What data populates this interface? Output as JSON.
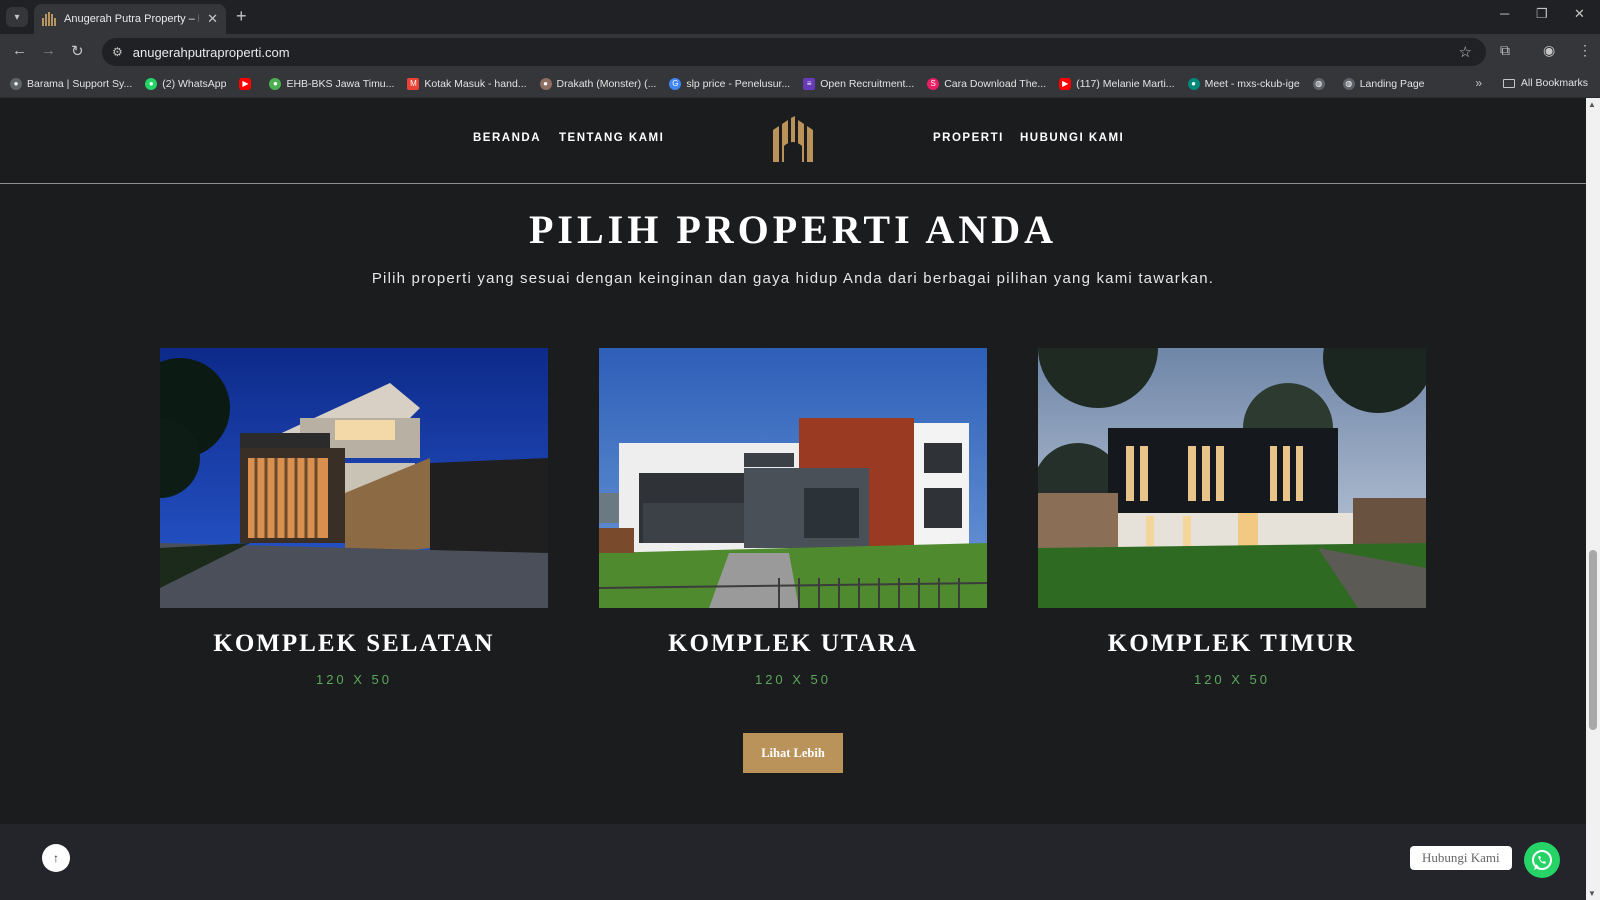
{
  "browser": {
    "tab_title": "Anugerah Putra Property – Kes",
    "url": "anugerahputraproperti.com",
    "bookmarks": [
      {
        "label": "Barama | Support Sy...",
        "color": "#5f6368"
      },
      {
        "label": "(2) WhatsApp",
        "color": "#25d366"
      },
      {
        "label": "",
        "color": "#ff0000"
      },
      {
        "label": "EHB-BKS Jawa Timu...",
        "color": "#4caf50"
      },
      {
        "label": "Kotak Masuk - hand...",
        "color": "#ea4335"
      },
      {
        "label": "Drakath (Monster) (...",
        "color": "#8d6e63"
      },
      {
        "label": "slp price - Penelusur...",
        "color": "#4285f4"
      },
      {
        "label": "Open Recruitment...",
        "color": "#673ab7"
      },
      {
        "label": "Cara Download The...",
        "color": "#e91e63"
      },
      {
        "label": "(117) Melanie Marti...",
        "color": "#ff0000"
      },
      {
        "label": "Meet - mxs-ckub-ige",
        "color": "#00897b"
      },
      {
        "label": "",
        "color": "#5f6368"
      },
      {
        "label": "Landing Page",
        "color": "#5f6368"
      }
    ],
    "all_bookmarks": "All Bookmarks"
  },
  "nav": {
    "home": "BERANDA",
    "about": "TENTANG KAMI",
    "property": "PROPERTI",
    "contact": "HUBUNGI KAMI"
  },
  "section": {
    "title": "PILIH PROPERTI ANDA",
    "subtitle": "Pilih properti yang sesuai dengan keinginan dan gaya hidup Anda dari berbagai pilihan yang kami tawarkan."
  },
  "properties": [
    {
      "name": "KOMPLEK SELATAN",
      "size": "120 X 50"
    },
    {
      "name": "KOMPLEK UTARA",
      "size": "120 X 50"
    },
    {
      "name": "KOMPLEK TIMUR",
      "size": "120 X 50"
    }
  ],
  "cta": {
    "label": "Lihat Lebih"
  },
  "floating": {
    "whatsapp_label": "Hubungi Kami"
  },
  "colors": {
    "accent": "#b9935a",
    "size_text": "#5ca85c",
    "background": "#1b1c1e"
  }
}
